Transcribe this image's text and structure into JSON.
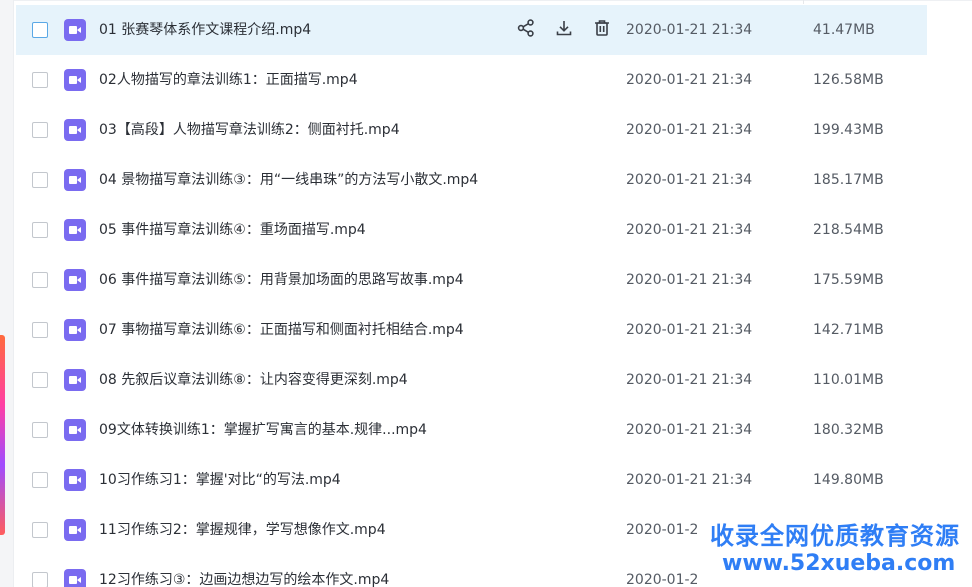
{
  "files": [
    {
      "name": "01 张赛琴体系作文课程介绍.mp4",
      "date": "2020-01-21 21:34",
      "size": "41.47MB",
      "selected": true
    },
    {
      "name": "02人物描写的章法训练1：正面描写.mp4",
      "date": "2020-01-21 21:34",
      "size": "126.58MB"
    },
    {
      "name": "03【高段】人物描写章法训练2：侧面衬托.mp4",
      "date": "2020-01-21 21:34",
      "size": "199.43MB"
    },
    {
      "name": "04 景物描写章法训练③：用“一线串珠”的方法写小散文.mp4",
      "date": "2020-01-21 21:34",
      "size": "185.17MB"
    },
    {
      "name": "05 事件描写章法训练④：重场面描写.mp4",
      "date": "2020-01-21 21:34",
      "size": "218.54MB"
    },
    {
      "name": "06 事件描写章法训练⑤：用背景加场面的思路写故事.mp4",
      "date": "2020-01-21 21:34",
      "size": "175.59MB"
    },
    {
      "name": "07 事物描写章法训练⑥：正面描写和侧面衬托相结合.mp4",
      "date": "2020-01-21 21:34",
      "size": "142.71MB"
    },
    {
      "name": "08 先叙后议章法训练⑧：让内容变得更深刻.mp4",
      "date": "2020-01-21 21:34",
      "size": "110.01MB"
    },
    {
      "name": "09文体转换训练1：掌握扩写寓言的基本.规律...mp4",
      "date": "2020-01-21 21:34",
      "size": "180.32MB"
    },
    {
      "name": "10习作练习1：掌握'对比“的写法.mp4",
      "date": "2020-01-21 21:34",
      "size": "149.80MB"
    },
    {
      "name": "11习作练习2：掌握规律，学写想像作文.mp4",
      "date": "2020-01-2",
      "size": ""
    },
    {
      "name": "12习作练习③：边画边想边写的绘本作文.mp4",
      "date": "2020-01-2",
      "size": ""
    }
  ],
  "row_actions": {
    "share_icon": "share-icon",
    "download_icon": "download-icon",
    "delete_icon": "trash-icon"
  },
  "watermark": {
    "line1": "收录全网优质教育资源",
    "line2": "www.52xueba.com",
    "color": "#2f7ef5"
  },
  "colors": {
    "selected_row": "#e6f3fb",
    "video_icon": "#7a6bf0"
  }
}
